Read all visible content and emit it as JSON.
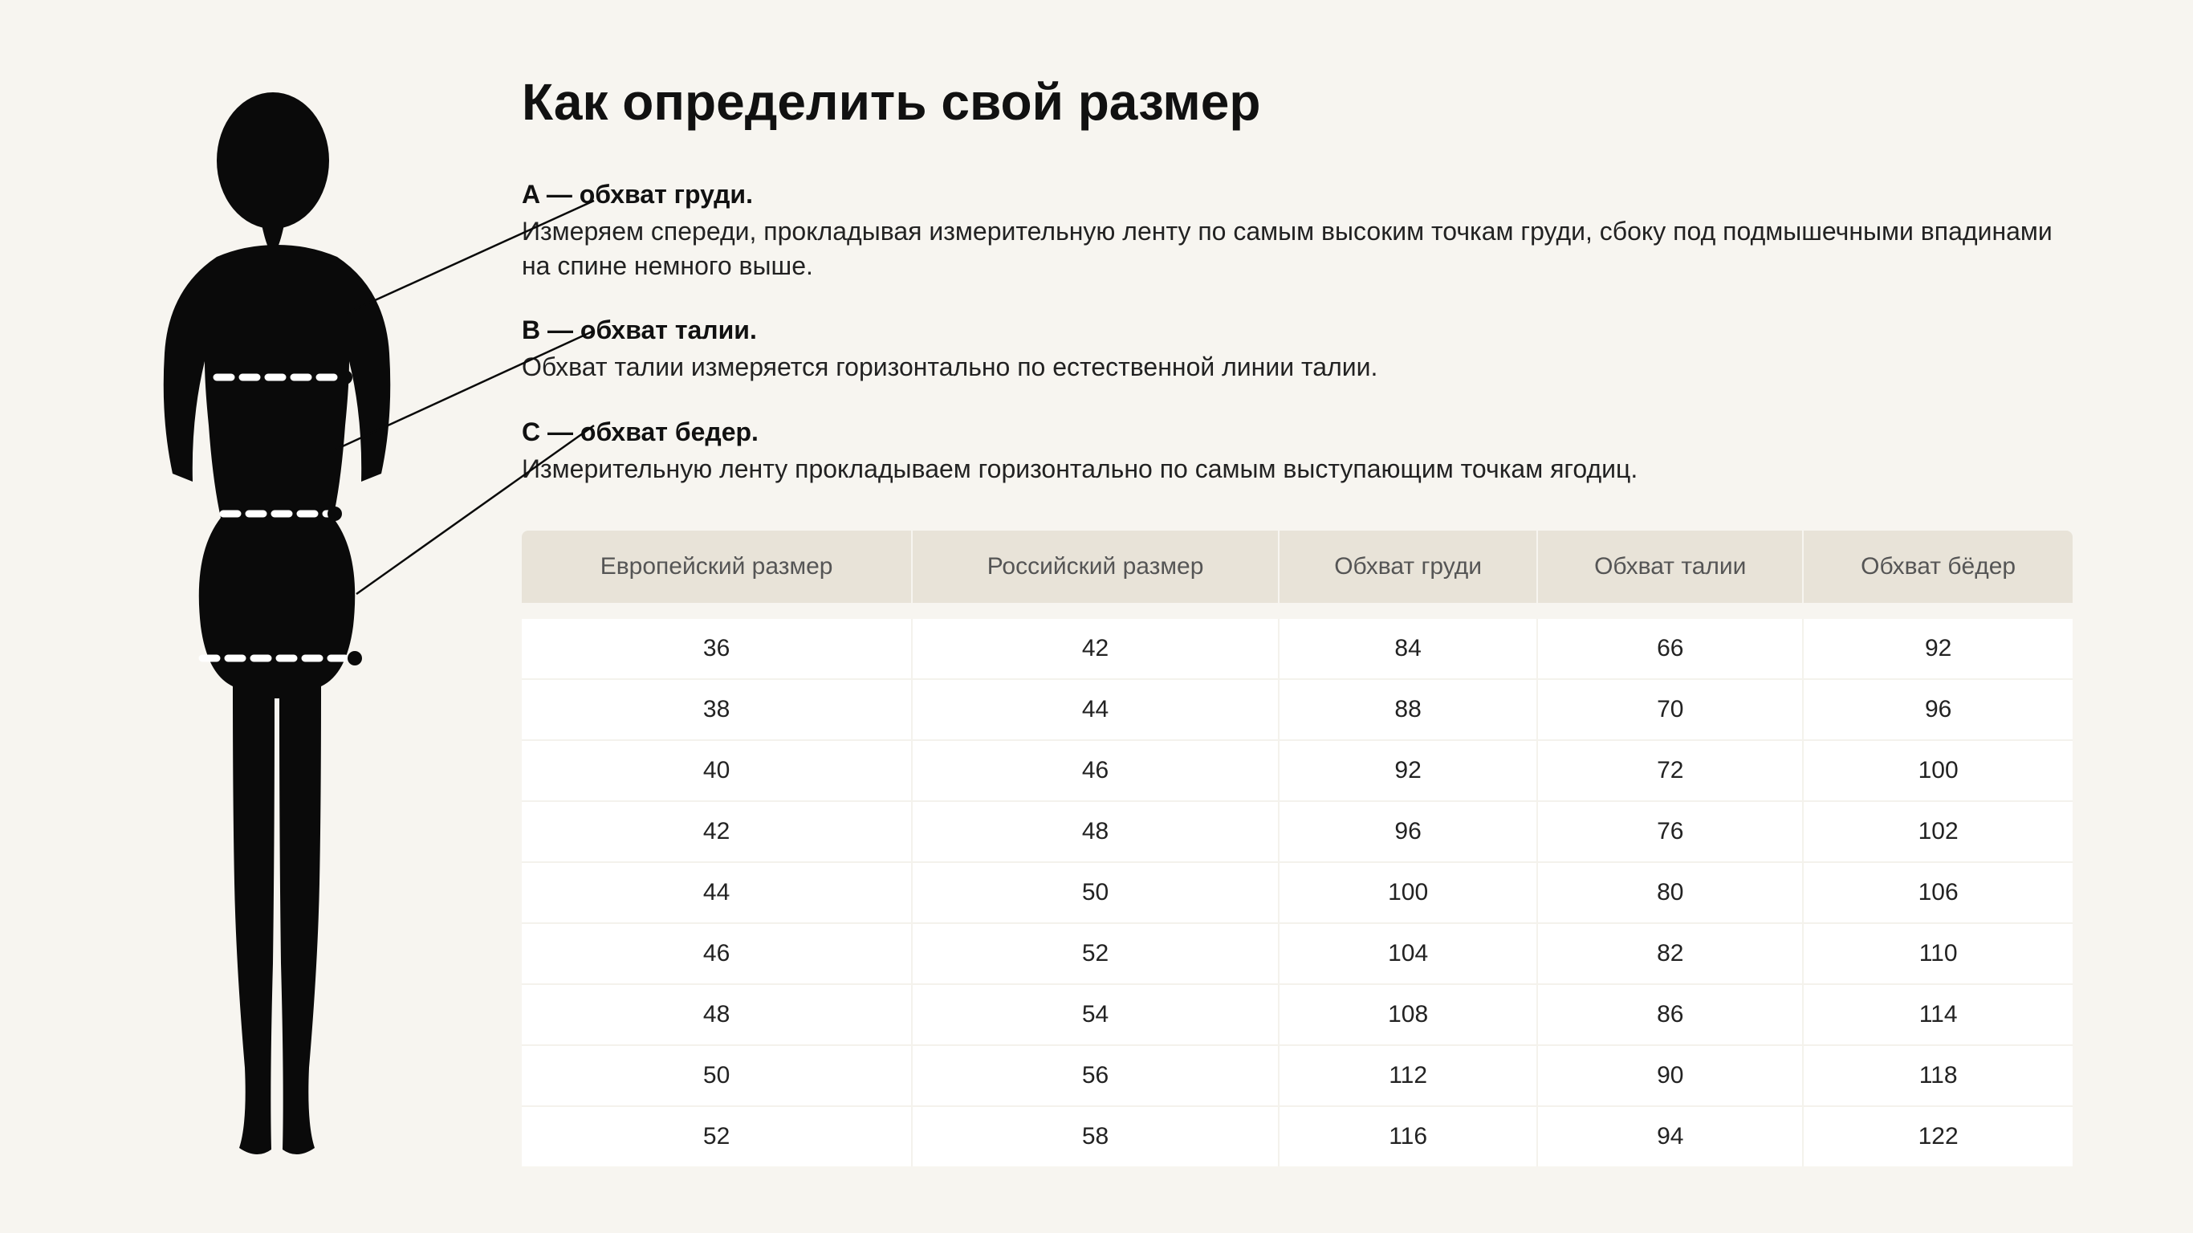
{
  "title": "Как определить свой размер",
  "measurements": {
    "a": {
      "label": "A — обхват груди.",
      "desc": "Измеряем спереди, прокладывая измерительную ленту по самым высоким точкам груди, сбоку под подмышечными впадинами на спине немного выше."
    },
    "b": {
      "label": "B — обхват талии.",
      "desc": "Обхват талии измеряется горизонтально по естественной линии талии."
    },
    "c": {
      "label": "C — обхват бедер.",
      "desc": "Измерительную ленту прокладываем горизонтально по самым выступающим точкам ягодиц."
    }
  },
  "table": {
    "headers": [
      "Европейский размер",
      "Российский размер",
      "Обхват груди",
      "Обхват талии",
      "Обхват бёдер"
    ],
    "rows": [
      [
        36,
        42,
        84,
        66,
        92
      ],
      [
        38,
        44,
        88,
        70,
        96
      ],
      [
        40,
        46,
        92,
        72,
        100
      ],
      [
        42,
        48,
        96,
        76,
        102
      ],
      [
        44,
        50,
        100,
        80,
        106
      ],
      [
        46,
        52,
        104,
        82,
        110
      ],
      [
        48,
        54,
        108,
        86,
        114
      ],
      [
        50,
        56,
        112,
        90,
        118
      ],
      [
        52,
        58,
        116,
        94,
        122
      ]
    ]
  }
}
